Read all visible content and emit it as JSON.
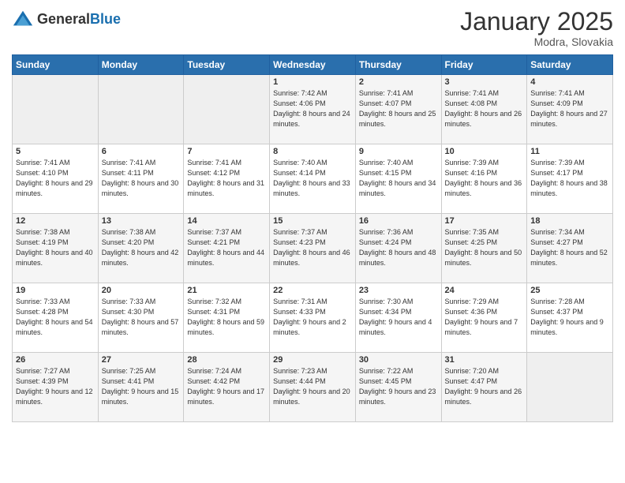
{
  "header": {
    "logo_general": "General",
    "logo_blue": "Blue",
    "title": "January 2025",
    "location": "Modra, Slovakia"
  },
  "days_of_week": [
    "Sunday",
    "Monday",
    "Tuesday",
    "Wednesday",
    "Thursday",
    "Friday",
    "Saturday"
  ],
  "weeks": [
    [
      {
        "day": "",
        "empty": true
      },
      {
        "day": "",
        "empty": true
      },
      {
        "day": "",
        "empty": true
      },
      {
        "day": "1",
        "sunrise": "7:42 AM",
        "sunset": "4:06 PM",
        "daylight": "8 hours and 24 minutes."
      },
      {
        "day": "2",
        "sunrise": "7:41 AM",
        "sunset": "4:07 PM",
        "daylight": "8 hours and 25 minutes."
      },
      {
        "day": "3",
        "sunrise": "7:41 AM",
        "sunset": "4:08 PM",
        "daylight": "8 hours and 26 minutes."
      },
      {
        "day": "4",
        "sunrise": "7:41 AM",
        "sunset": "4:09 PM",
        "daylight": "8 hours and 27 minutes."
      }
    ],
    [
      {
        "day": "5",
        "sunrise": "7:41 AM",
        "sunset": "4:10 PM",
        "daylight": "8 hours and 29 minutes."
      },
      {
        "day": "6",
        "sunrise": "7:41 AM",
        "sunset": "4:11 PM",
        "daylight": "8 hours and 30 minutes."
      },
      {
        "day": "7",
        "sunrise": "7:41 AM",
        "sunset": "4:12 PM",
        "daylight": "8 hours and 31 minutes."
      },
      {
        "day": "8",
        "sunrise": "7:40 AM",
        "sunset": "4:14 PM",
        "daylight": "8 hours and 33 minutes."
      },
      {
        "day": "9",
        "sunrise": "7:40 AM",
        "sunset": "4:15 PM",
        "daylight": "8 hours and 34 minutes."
      },
      {
        "day": "10",
        "sunrise": "7:39 AM",
        "sunset": "4:16 PM",
        "daylight": "8 hours and 36 minutes."
      },
      {
        "day": "11",
        "sunrise": "7:39 AM",
        "sunset": "4:17 PM",
        "daylight": "8 hours and 38 minutes."
      }
    ],
    [
      {
        "day": "12",
        "sunrise": "7:38 AM",
        "sunset": "4:19 PM",
        "daylight": "8 hours and 40 minutes."
      },
      {
        "day": "13",
        "sunrise": "7:38 AM",
        "sunset": "4:20 PM",
        "daylight": "8 hours and 42 minutes."
      },
      {
        "day": "14",
        "sunrise": "7:37 AM",
        "sunset": "4:21 PM",
        "daylight": "8 hours and 44 minutes."
      },
      {
        "day": "15",
        "sunrise": "7:37 AM",
        "sunset": "4:23 PM",
        "daylight": "8 hours and 46 minutes."
      },
      {
        "day": "16",
        "sunrise": "7:36 AM",
        "sunset": "4:24 PM",
        "daylight": "8 hours and 48 minutes."
      },
      {
        "day": "17",
        "sunrise": "7:35 AM",
        "sunset": "4:25 PM",
        "daylight": "8 hours and 50 minutes."
      },
      {
        "day": "18",
        "sunrise": "7:34 AM",
        "sunset": "4:27 PM",
        "daylight": "8 hours and 52 minutes."
      }
    ],
    [
      {
        "day": "19",
        "sunrise": "7:33 AM",
        "sunset": "4:28 PM",
        "daylight": "8 hours and 54 minutes."
      },
      {
        "day": "20",
        "sunrise": "7:33 AM",
        "sunset": "4:30 PM",
        "daylight": "8 hours and 57 minutes."
      },
      {
        "day": "21",
        "sunrise": "7:32 AM",
        "sunset": "4:31 PM",
        "daylight": "8 hours and 59 minutes."
      },
      {
        "day": "22",
        "sunrise": "7:31 AM",
        "sunset": "4:33 PM",
        "daylight": "9 hours and 2 minutes."
      },
      {
        "day": "23",
        "sunrise": "7:30 AM",
        "sunset": "4:34 PM",
        "daylight": "9 hours and 4 minutes."
      },
      {
        "day": "24",
        "sunrise": "7:29 AM",
        "sunset": "4:36 PM",
        "daylight": "9 hours and 7 minutes."
      },
      {
        "day": "25",
        "sunrise": "7:28 AM",
        "sunset": "4:37 PM",
        "daylight": "9 hours and 9 minutes."
      }
    ],
    [
      {
        "day": "26",
        "sunrise": "7:27 AM",
        "sunset": "4:39 PM",
        "daylight": "9 hours and 12 minutes."
      },
      {
        "day": "27",
        "sunrise": "7:25 AM",
        "sunset": "4:41 PM",
        "daylight": "9 hours and 15 minutes."
      },
      {
        "day": "28",
        "sunrise": "7:24 AM",
        "sunset": "4:42 PM",
        "daylight": "9 hours and 17 minutes."
      },
      {
        "day": "29",
        "sunrise": "7:23 AM",
        "sunset": "4:44 PM",
        "daylight": "9 hours and 20 minutes."
      },
      {
        "day": "30",
        "sunrise": "7:22 AM",
        "sunset": "4:45 PM",
        "daylight": "9 hours and 23 minutes."
      },
      {
        "day": "31",
        "sunrise": "7:20 AM",
        "sunset": "4:47 PM",
        "daylight": "9 hours and 26 minutes."
      },
      {
        "day": "",
        "empty": true
      }
    ]
  ]
}
